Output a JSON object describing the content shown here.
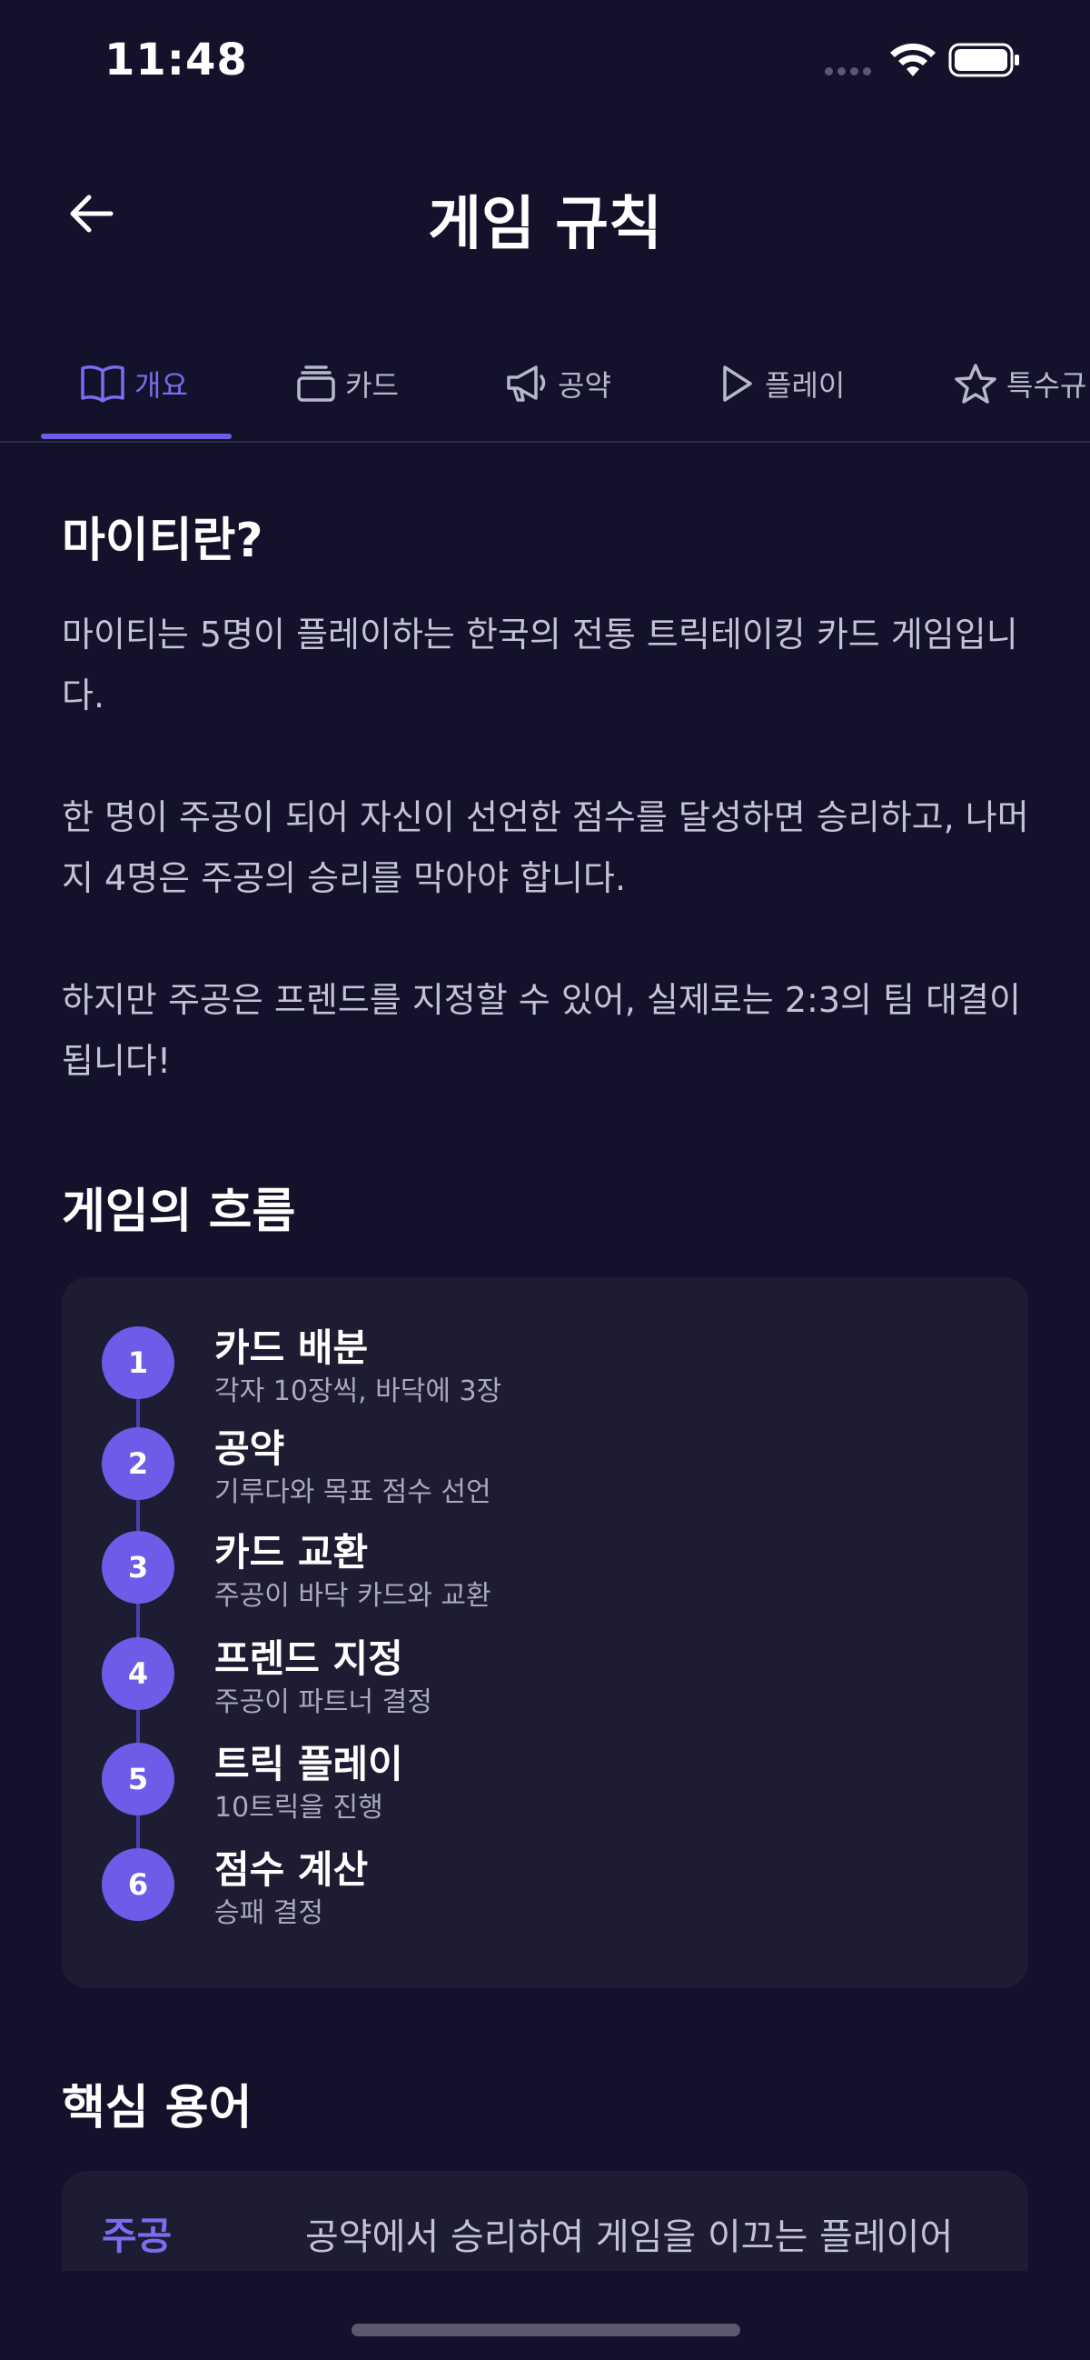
{
  "status_bar": {
    "time": "11:48"
  },
  "header": {
    "title": "게임 규칙"
  },
  "tabs": [
    {
      "label": "개요",
      "icon": "book-icon",
      "active": true
    },
    {
      "label": "카드",
      "icon": "card-stack-icon",
      "active": false
    },
    {
      "label": "공약",
      "icon": "megaphone-icon",
      "active": false
    },
    {
      "label": "플레이",
      "icon": "play-icon",
      "active": false
    },
    {
      "label": "특수규",
      "icon": "star-icon",
      "active": false
    }
  ],
  "intro": {
    "title": "마이티란?",
    "paragraphs": [
      "마이티는 5명이 플레이하는 한국의 전통 트릭테이킹 카드 게임입니다.",
      "한 명이 주공이 되어 자신이 선언한 점수를 달성하면 승리하고, 나머지 4명은 주공의 승리를 막아야 합니다.",
      "하지만 주공은 프렌드를 지정할 수 있어, 실제로는 2:3의 팀 대결이 됩니다!"
    ]
  },
  "flow": {
    "title": "게임의 흐름",
    "steps": [
      {
        "number": "1",
        "title": "카드 배분",
        "desc": "각자 10장씩, 바닥에 3장"
      },
      {
        "number": "2",
        "title": "공약",
        "desc": "기루다와 목표 점수 선언"
      },
      {
        "number": "3",
        "title": "카드 교환",
        "desc": "주공이 바닥 카드와 교환"
      },
      {
        "number": "4",
        "title": "프렌드 지정",
        "desc": "주공이 파트너 결정"
      },
      {
        "number": "5",
        "title": "트릭 플레이",
        "desc": "10트릭을 진행"
      },
      {
        "number": "6",
        "title": "점수 계산",
        "desc": "승패 결정"
      }
    ]
  },
  "terms": {
    "title": "핵심 용어",
    "items": [
      {
        "name": "주공",
        "definition": "공약에서 승리하여 게임을 이끄는 플레이어"
      }
    ]
  },
  "colors": {
    "background": "#13122a",
    "accent": "#6c5ce7",
    "card": "#1d1c32"
  }
}
